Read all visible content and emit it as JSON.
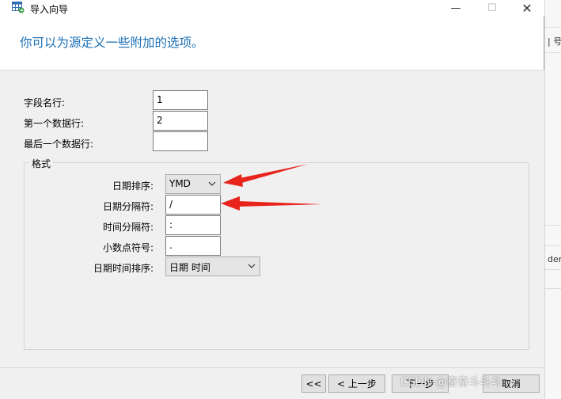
{
  "window": {
    "title": "导入向导",
    "minimize_glyph": "—",
    "maximize_glyph": "☐",
    "close_glyph": "✕"
  },
  "heading": "你可以为源定义一些附加的选项。",
  "fields": {
    "field_name_row": {
      "label": "字段名行:",
      "value": "1"
    },
    "first_data_row": {
      "label": "第一个数据行:",
      "value": "2"
    },
    "last_data_row": {
      "label": "最后一个数据行:",
      "value": ""
    }
  },
  "format": {
    "legend": "格式",
    "date_order": {
      "label": "日期排序:",
      "value": "YMD"
    },
    "date_separator": {
      "label": "日期分隔符:",
      "value": "/"
    },
    "time_separator": {
      "label": "时间分隔符:",
      "value": ":"
    },
    "decimal_symbol": {
      "label": "小数点符号:",
      "value": "."
    },
    "datetime_order": {
      "label": "日期时间排序:",
      "value": "日期 时间"
    }
  },
  "buttons": {
    "first": "<<",
    "back": "< 上一步",
    "next": "下一步",
    "cancel": "取消"
  },
  "background_app": {
    "text_top": "| 号",
    "text_mid": "der"
  },
  "watermark": "CSDN @奋奋斗斗斗",
  "colors": {
    "heading": "#1a6fb5",
    "arrow": "#e8231c"
  },
  "icons": {
    "title_icon": "table-import-icon",
    "dropdown": "chevron-down-icon"
  }
}
